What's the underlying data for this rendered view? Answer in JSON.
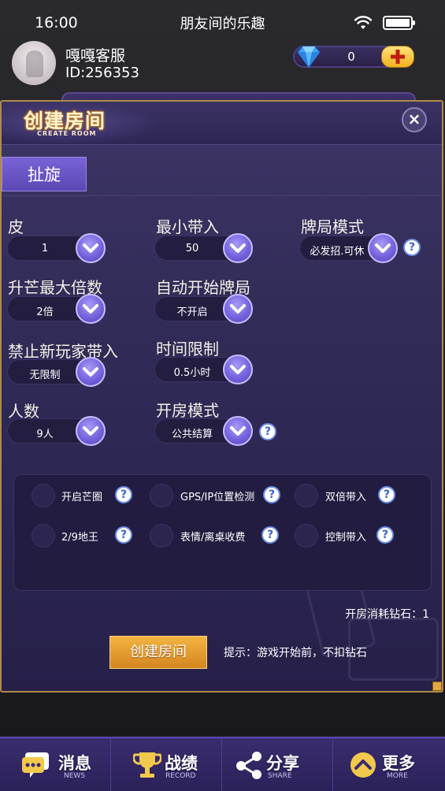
{
  "status_bar": {
    "time": "16:00",
    "title": "朋友间的乐趣"
  },
  "user": {
    "name": "嘎嘎客服",
    "id": "ID:256353",
    "diamonds": "0"
  },
  "dialog": {
    "title": "创建房间",
    "subtitle": "CREATE  ROOM",
    "close_label": "×",
    "tab": "扯旋",
    "fields": {
      "pi": {
        "label": "皮",
        "value": "1"
      },
      "min_buyin": {
        "label": "最小带入",
        "value": "50"
      },
      "game_mode": {
        "label": "牌局模式",
        "value": "必发招.可休"
      },
      "max_multiplier": {
        "label": "升芒最大倍数",
        "value": "2倍"
      },
      "auto_start": {
        "label": "自动开始牌局",
        "value": "不开启"
      },
      "ban_new_buyin": {
        "label": "禁止新玩家带入",
        "value": "无限制"
      },
      "time_limit": {
        "label": "时间限制",
        "value": "0.5小时"
      },
      "players": {
        "label": "人数",
        "value": "9人"
      },
      "room_mode": {
        "label": "开房模式",
        "value": "公共结算"
      }
    },
    "options": [
      {
        "label": "开启芒圈"
      },
      {
        "label": "GPS/IP位置检测"
      },
      {
        "label": "双倍带入"
      },
      {
        "label": "2/9地王"
      },
      {
        "label": "表情/离桌收费"
      },
      {
        "label": "控制带入"
      }
    ],
    "help_mark": "?",
    "cost": "开房消耗钻石：1",
    "create_button": "创建房间",
    "hint": "提示：游戏开始前，不扣钻石"
  },
  "nav": [
    {
      "label": "消息",
      "sub": "NEWS",
      "icon": "chat-icon"
    },
    {
      "label": "战绩",
      "sub": "RECORD",
      "icon": "trophy-icon"
    },
    {
      "label": "分享",
      "sub": "SHARE",
      "icon": "share-icon"
    },
    {
      "label": "更多",
      "sub": "MORE",
      "icon": "chevron-up-icon"
    }
  ],
  "colors": {
    "accent": "#7563de",
    "gold": "#b08a4a",
    "button": "#e39a2c"
  }
}
